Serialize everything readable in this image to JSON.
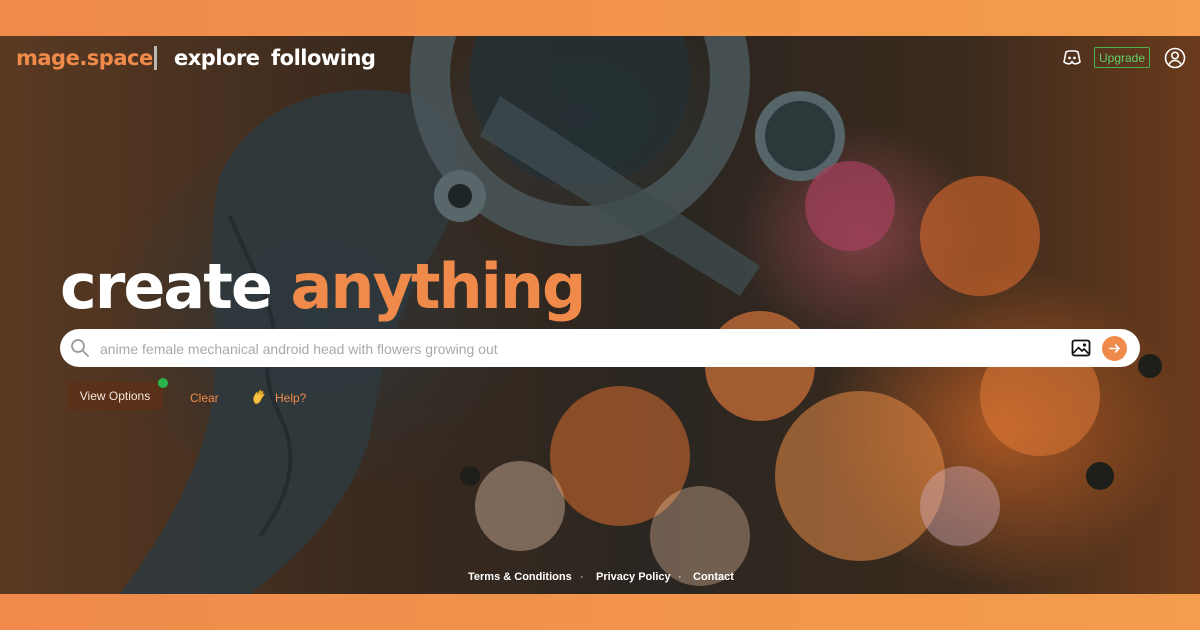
{
  "header": {
    "logo": "mage.space",
    "nav": [
      {
        "label": "explore"
      },
      {
        "label": "following"
      }
    ],
    "upgrade_label": "Upgrade",
    "icons": {
      "discord": "discord-icon",
      "account": "user-circle-icon"
    }
  },
  "hero": {
    "title_white": "create",
    "title_orange": "anything"
  },
  "search": {
    "placeholder": "anime female mechanical android head with flowers growing out",
    "icons": {
      "search": "search-icon",
      "image": "image-icon",
      "submit": "arrow-right-icon"
    }
  },
  "controls": {
    "view_options_label": "View Options",
    "clear_label": "Clear",
    "help_label": "Help?",
    "help_icon": "waving-hand-icon"
  },
  "footer": {
    "links": [
      "Terms & Conditions",
      "Privacy Policy",
      "Contact"
    ],
    "separator": "·"
  },
  "colors": {
    "brand_orange": "#f08a4b",
    "upgrade_green": "#4caf50",
    "status_dot": "#29b34a",
    "button_brown": "#5a3018"
  }
}
